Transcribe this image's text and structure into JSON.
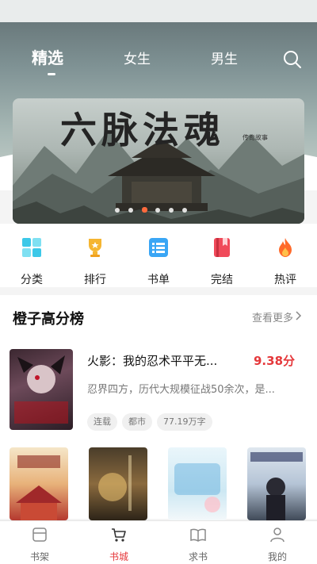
{
  "tabs": [
    {
      "label": "精选",
      "active": true
    },
    {
      "label": "女生",
      "active": false
    },
    {
      "label": "男生",
      "active": false
    }
  ],
  "banner": {
    "title": "六脉法魂",
    "subtitle": "传奇故事",
    "dots_count": 6,
    "active_dot": 3
  },
  "categories": [
    {
      "label": "分类",
      "icon": "grid-icon"
    },
    {
      "label": "排行",
      "icon": "trophy-icon"
    },
    {
      "label": "书单",
      "icon": "list-icon"
    },
    {
      "label": "完结",
      "icon": "book-icon"
    },
    {
      "label": "热评",
      "icon": "flame-icon"
    }
  ],
  "section": {
    "title": "橙子高分榜",
    "see_more": "查看更多"
  },
  "featured_book": {
    "title": "火影：我的忍术平平无...",
    "score": "9.38分",
    "description": "忍界四方，历代大规模征战50余次，是...",
    "tags": [
      "连载",
      "都市",
      "77.19万字"
    ],
    "cover_text": "火影 我的忍术 平平无奇"
  },
  "more_covers": [
    {
      "text": "重生皇女 我真没想当女帝"
    },
    {
      "text": "锦绣宫阙"
    },
    {
      "text": "总裁你别来纠缠我"
    },
    {
      "text": "西游开始 华夏神话"
    }
  ],
  "bottom_nav": [
    {
      "label": "书架",
      "icon": "bookshelf-icon",
      "active": false
    },
    {
      "label": "书城",
      "icon": "cart-icon",
      "active": true
    },
    {
      "label": "求书",
      "icon": "open-book-icon",
      "active": false
    },
    {
      "label": "我的",
      "icon": "person-icon",
      "active": false
    }
  ],
  "colors": {
    "accent": "#e5383b",
    "score": "#e5383b"
  }
}
